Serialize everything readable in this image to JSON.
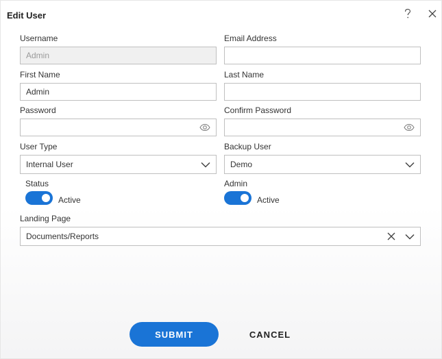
{
  "dialog": {
    "title": "Edit User",
    "help_icon": "question-mark-icon",
    "close_icon": "close-icon"
  },
  "form": {
    "username": {
      "label": "Username",
      "value": "Admin"
    },
    "email": {
      "label": "Email Address",
      "value": ""
    },
    "first_name": {
      "label": "First Name",
      "value": "Admin"
    },
    "last_name": {
      "label": "Last Name",
      "value": ""
    },
    "password": {
      "label": "Password",
      "value": "",
      "icon": "eye-icon"
    },
    "confirm_password": {
      "label": "Confirm Password",
      "value": "",
      "icon": "eye-icon"
    },
    "user_type": {
      "label": "User Type",
      "value": "Internal User",
      "icon": "chevron-down-icon"
    },
    "backup_user": {
      "label": "Backup User",
      "value": "Demo",
      "icon": "chevron-down-icon"
    },
    "status": {
      "label": "Status",
      "state_label": "Active",
      "on": true
    },
    "admin": {
      "label": "Admin",
      "state_label": "Active",
      "on": true
    },
    "landing_page": {
      "label": "Landing Page",
      "value": "Documents/Reports",
      "clear_icon": "clear-icon",
      "icon": "chevron-down-icon"
    }
  },
  "actions": {
    "submit_label": "SUBMIT",
    "cancel_label": "CANCEL"
  },
  "colors": {
    "accent": "#1a74d6",
    "readonly_bg": "#f0f0f0",
    "border": "#bfbfbf"
  }
}
